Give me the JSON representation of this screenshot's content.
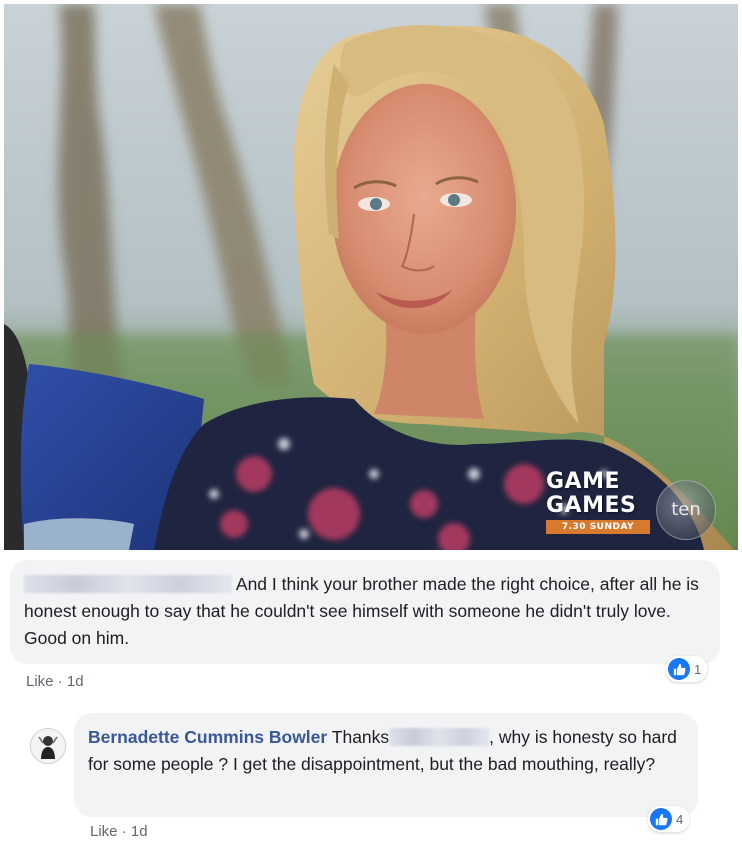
{
  "video": {
    "show_title_line1": "GAME",
    "show_title_line2": "GAMES",
    "air_time": "7.30 SUNDAY",
    "network_logo": "ten"
  },
  "comments": [
    {
      "author_redacted": true,
      "text": "And I think your brother made the right choice, after all he is honest enough to say that he couldn't see himself with someone he didn't truly love. Good on him.",
      "like_label": "Like",
      "separator": "·",
      "timestamp": "1d",
      "reaction_count": "1"
    },
    {
      "author": "Bernadette Cummins Bowler",
      "text_before": "Thanks",
      "text_after": ", why is honesty so hard for some people ? I get the disappointment, but the bad mouthing, really?",
      "like_label": "Like",
      "separator": "·",
      "timestamp": "1d",
      "reaction_count": "4"
    }
  ],
  "colors": {
    "author_link": "#385898",
    "reaction_blue": "#1877f2",
    "bubble_bg": "#f2f3f5"
  },
  "icons": {
    "reaction": "thumbs-up-icon",
    "avatar": "profile-picture"
  }
}
